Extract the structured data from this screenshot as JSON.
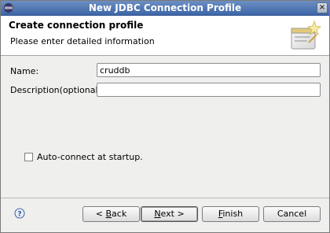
{
  "window": {
    "title": "New JDBC Connection Profile"
  },
  "banner": {
    "title": "Create connection profile",
    "subtitle": "Please enter detailed information"
  },
  "form": {
    "name_label": "Name:",
    "name_value": "cruddb",
    "description_label": "Description(optional):",
    "description_value": "",
    "autoconnect_label": "Auto-connect at startup.",
    "autoconnect_checked": false
  },
  "buttons": {
    "back_mnemonic": "B",
    "back_rest": "ack",
    "back_prefix": "< ",
    "next_mnemonic": "N",
    "next_rest": "ext >",
    "finish_mnemonic": "F",
    "finish_rest": "inish",
    "cancel_label": "Cancel"
  },
  "icons": {
    "app": "eclipse-icon",
    "close": "close-icon",
    "wizard": "wizard-banner-icon",
    "help": "help-icon"
  }
}
